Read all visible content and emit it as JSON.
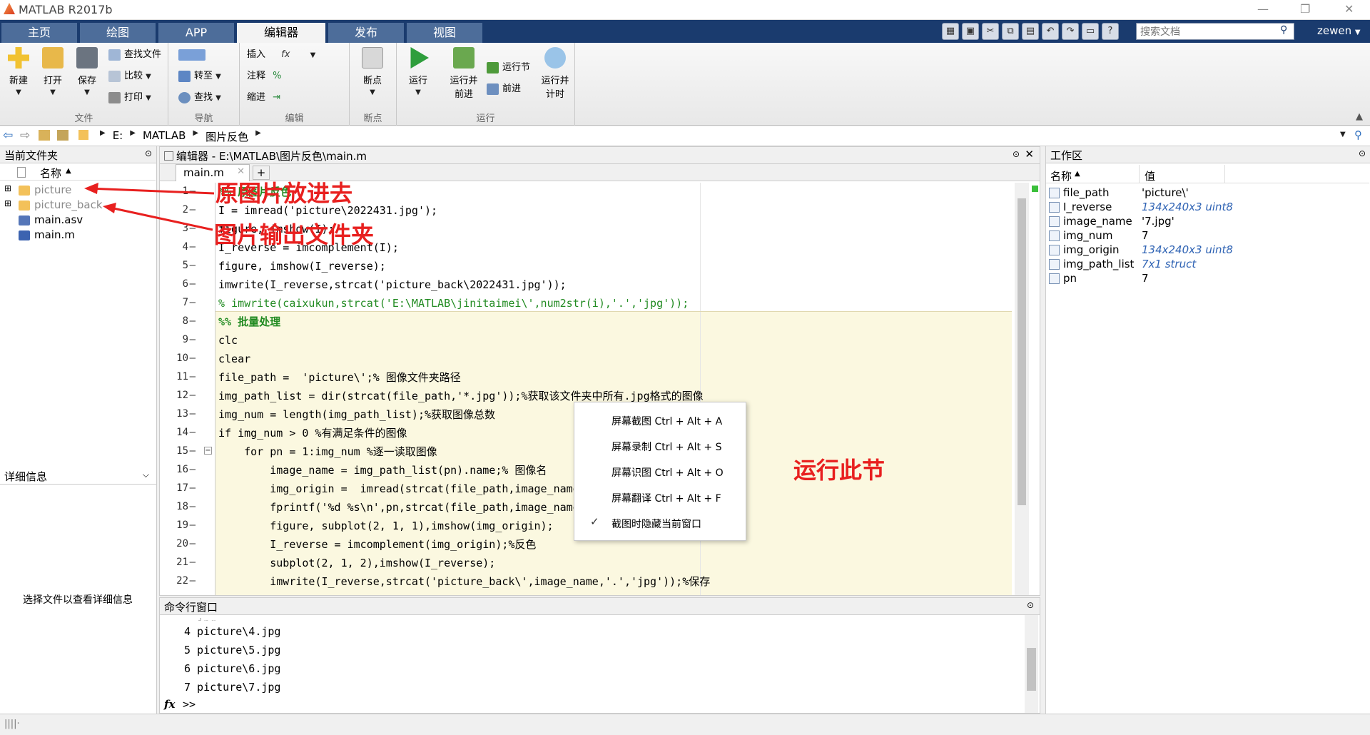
{
  "app": {
    "title": "MATLAB R2017b",
    "user": "zewen"
  },
  "tabs": [
    "主页",
    "绘图",
    "APP",
    "编辑器",
    "发布",
    "视图"
  ],
  "search": {
    "placeholder": "搜索文档"
  },
  "ribbon": {
    "file": {
      "label": "文件",
      "new": "新建",
      "open": "打开",
      "save": "保存",
      "find": "查找文件",
      "compare": "比较",
      "print": "打印"
    },
    "nav": {
      "label": "导航",
      "goto": "转至",
      "find": "查找"
    },
    "edit": {
      "label": "编辑",
      "insert": "插入",
      "comment": "注释",
      "indent": "缩进"
    },
    "breakpoints": {
      "label": "断点",
      "btn": "断点"
    },
    "run": {
      "label": "运行",
      "run": "运行",
      "run_advance": "运行并\n前进",
      "run_section": "运行节",
      "advance": "前进",
      "run_time": "运行并\n计时"
    }
  },
  "address": {
    "crumbs": [
      "E:",
      "MATLAB",
      "图片反色"
    ]
  },
  "files": {
    "title": "当前文件夹",
    "col": "名称",
    "items": [
      "picture",
      "picture_back",
      "main.asv",
      "main.m"
    ]
  },
  "details": {
    "title": "详细信息",
    "hint": "选择文件以查看详细信息"
  },
  "editor": {
    "title": "编辑器 - E:\\MATLAB\\图片反色\\main.m",
    "tab": "main.m",
    "lines": [
      {
        "n": "1",
        "text": "%% 原图片反色",
        "color": "#228b22",
        "bold": true
      },
      {
        "n": "2",
        "text": "I = imread('picture\\2022431.jpg');"
      },
      {
        "n": "3",
        "text": "figure, imshow(I);"
      },
      {
        "n": "4",
        "text": "I_reverse = imcomplement(I);"
      },
      {
        "n": "5",
        "text": "figure, imshow(I_reverse);"
      },
      {
        "n": "6",
        "text": "imwrite(I_reverse,strcat('picture_back\\2022431.jpg'));"
      },
      {
        "n": "7",
        "text": "% imwrite(caixukun,strcat('E:\\MATLAB\\jinitaimei\\',num2str(i),'.','jpg'));",
        "color": "#228b22"
      },
      {
        "n": "8",
        "text": "%% 批量处理",
        "color": "#228b22",
        "bold": true
      },
      {
        "n": "9",
        "text": "clc"
      },
      {
        "n": "10",
        "text": "clear"
      },
      {
        "n": "11",
        "text": "file_path =  'picture\\';% 图像文件夹路径"
      },
      {
        "n": "12",
        "text": "img_path_list = dir(strcat(file_path,'*.jpg'));%获取该文件夹中所有.jpg格式的图像"
      },
      {
        "n": "13",
        "text": "img_num = length(img_path_list);%获取图像总数"
      },
      {
        "n": "14",
        "text": "if img_num > 0 %有满足条件的图像"
      },
      {
        "n": "15",
        "text": "    for pn = 1:img_num %逐一读取图像"
      },
      {
        "n": "16",
        "text": "        image_name = img_path_list(pn).name;% 图像名"
      },
      {
        "n": "17",
        "text": "        img_origin =  imread(strcat(file_path,image_name));%读取图像"
      },
      {
        "n": "18",
        "text": "        fprintf('%d %s\\n',pn,strcat(file_path,image_name));% 显示正在处理的图像名"
      },
      {
        "n": "19",
        "text": "        figure, subplot(2, 1, 1),imshow(img_origin);"
      },
      {
        "n": "20",
        "text": "        I_reverse = imcomplement(img_origin);%反色"
      },
      {
        "n": "21",
        "text": "        subplot(2, 1, 2),imshow(I_reverse);"
      },
      {
        "n": "22",
        "text": "        imwrite(I_reverse,strcat('picture_back\\',image_name,'.','jpg'));%保存"
      }
    ]
  },
  "command": {
    "title": "命令行窗口",
    "lines": [
      "4 picture\\4.jpg",
      "5 picture\\5.jpg",
      "6 picture\\6.jpg",
      "7 picture\\7.jpg"
    ],
    "prompt": ">>"
  },
  "workspace": {
    "title": "工作区",
    "col_name": "名称",
    "col_value": "值",
    "rows": [
      {
        "name": "file_path",
        "value": "'picture\\'"
      },
      {
        "name": "I_reverse",
        "value": "134x240x3 uint8"
      },
      {
        "name": "image_name",
        "value": "'7.jpg'"
      },
      {
        "name": "img_num",
        "value": "7"
      },
      {
        "name": "img_origin",
        "value": "134x240x3 uint8"
      },
      {
        "name": "img_path_list",
        "value": "7x1 struct"
      },
      {
        "name": "pn",
        "value": "7"
      }
    ]
  },
  "context_menu": [
    "屏幕截图 Ctrl + Alt + A",
    "屏幕录制 Ctrl + Alt + S",
    "屏幕识图 Ctrl + Alt + O",
    "屏幕翻译 Ctrl + Alt + F",
    "截图时隐藏当前窗口"
  ],
  "annotations": {
    "a1": "原图片放进去",
    "a2": "图片输出文件夹",
    "a3": "运行此节"
  },
  "colors": {
    "accent": "#1a3b6e",
    "annotation": "#e8201f",
    "section_bg": "#fbf8e0"
  }
}
